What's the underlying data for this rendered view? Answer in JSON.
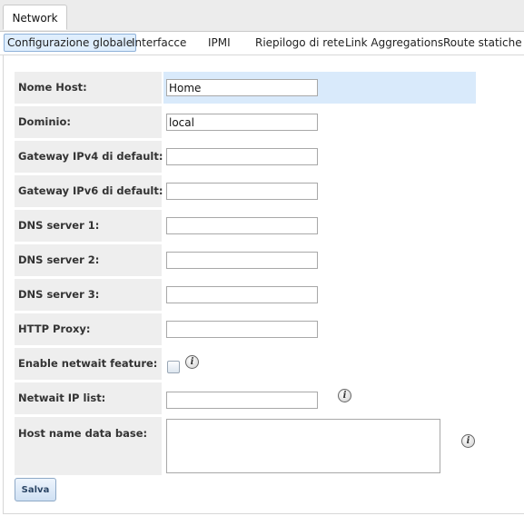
{
  "outer_tab": {
    "label": "Network"
  },
  "subtabs": [
    {
      "label": "Configurazione globale",
      "active": true
    },
    {
      "label": "Interfacce"
    },
    {
      "label": "IPMI"
    },
    {
      "label": "Riepilogo di rete"
    },
    {
      "label": "Link Aggregations"
    },
    {
      "label": "Route statiche"
    }
  ],
  "form": {
    "hostname": {
      "label": "Nome Host:",
      "value": "Home"
    },
    "domain": {
      "label": "Dominio:",
      "value": "local"
    },
    "ipv4_gateway": {
      "label": "Gateway IPv4 di default:",
      "value": ""
    },
    "ipv6_gateway": {
      "label": "Gateway IPv6 di default:",
      "value": ""
    },
    "dns1": {
      "label": "DNS server 1:",
      "value": ""
    },
    "dns2": {
      "label": "DNS server 2:",
      "value": ""
    },
    "dns3": {
      "label": "DNS server 3:",
      "value": ""
    },
    "http_proxy": {
      "label": "HTTP Proxy:",
      "value": ""
    },
    "netwait_enabled": {
      "label": "Enable netwait feature:",
      "checked": false
    },
    "netwait_ip": {
      "label": "Netwait IP list:",
      "value": ""
    },
    "hosts_db": {
      "label": "Host name data base:",
      "value": ""
    }
  },
  "info_glyph": "i",
  "save_button": {
    "label": "Salva"
  },
  "colors": {
    "highlight_row": "#d9eafb",
    "label_bg": "#eeeeee",
    "active_tab": "#dfeefd"
  }
}
